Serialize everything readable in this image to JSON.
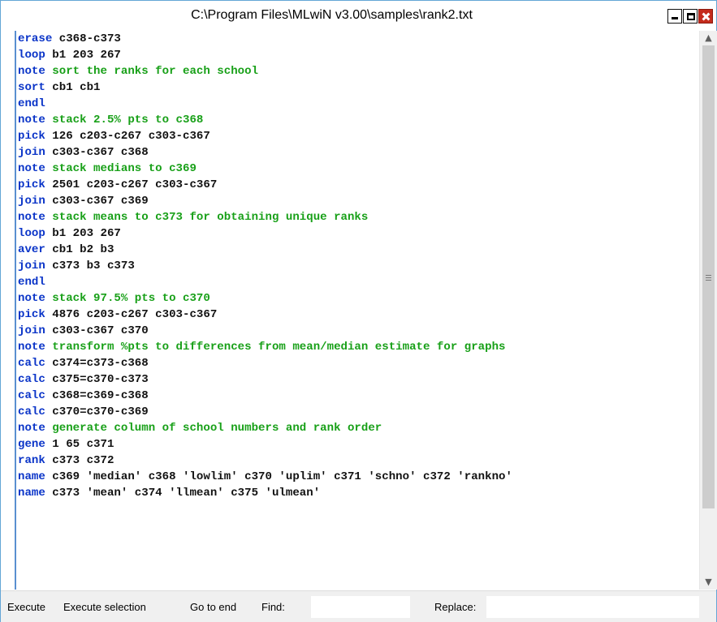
{
  "window": {
    "title": "C:\\Program Files\\MLwiN v3.00\\samples\\rank2.txt"
  },
  "editor": {
    "lines": [
      {
        "kw": "erase",
        "text": " c368-c373",
        "type": "cmd"
      },
      {
        "kw": "loop",
        "text": " b1 203 267",
        "type": "cmd"
      },
      {
        "kw": "note",
        "text": " sort the ranks for each school",
        "type": "note"
      },
      {
        "kw": "sort",
        "text": " cb1 cb1",
        "type": "cmd"
      },
      {
        "kw": "endl",
        "text": "",
        "type": "cmd"
      },
      {
        "kw": "note",
        "text": " stack 2.5% pts to c368",
        "type": "note"
      },
      {
        "kw": "pick",
        "text": " 126 c203-c267 c303-c367",
        "type": "cmd"
      },
      {
        "kw": "join",
        "text": " c303-c367 c368",
        "type": "cmd"
      },
      {
        "kw": "note",
        "text": " stack medians to c369",
        "type": "note"
      },
      {
        "kw": "pick",
        "text": " 2501 c203-c267 c303-c367",
        "type": "cmd"
      },
      {
        "kw": "join",
        "text": " c303-c367 c369",
        "type": "cmd"
      },
      {
        "kw": "note",
        "text": " stack means to c373 for obtaining unique ranks",
        "type": "note"
      },
      {
        "kw": "loop",
        "text": " b1 203 267",
        "type": "cmd"
      },
      {
        "kw": "aver",
        "text": " cb1 b2 b3",
        "type": "cmd"
      },
      {
        "kw": "join",
        "text": " c373 b3 c373",
        "type": "cmd"
      },
      {
        "kw": "endl",
        "text": "",
        "type": "cmd"
      },
      {
        "kw": "note",
        "text": " stack 97.5% pts to c370",
        "type": "note"
      },
      {
        "kw": "pick",
        "text": " 4876 c203-c267 c303-c367",
        "type": "cmd"
      },
      {
        "kw": "join",
        "text": " c303-c367 c370",
        "type": "cmd"
      },
      {
        "kw": "note",
        "text": " transform %pts to differences from mean/median estimate for graphs",
        "type": "note"
      },
      {
        "kw": "calc",
        "text": " c374=c373-c368",
        "type": "cmd"
      },
      {
        "kw": "calc",
        "text": " c375=c370-c373",
        "type": "cmd"
      },
      {
        "kw": "calc",
        "text": " c368=c369-c368",
        "type": "cmd"
      },
      {
        "kw": "calc",
        "text": " c370=c370-c369",
        "type": "cmd"
      },
      {
        "kw": "note",
        "text": " generate column of school numbers and rank order",
        "type": "note"
      },
      {
        "kw": "gene",
        "text": " 1 65 c371",
        "type": "cmd"
      },
      {
        "kw": "rank",
        "text": " c373 c372",
        "type": "cmd"
      },
      {
        "kw": "name",
        "text": " c369 'median' c368 'lowlim' c370 'uplim' c371 'schno' c372 'rankno'",
        "type": "cmd"
      },
      {
        "kw": "name",
        "text": " c373 'mean' c374 'llmean' c375 'ulmean'",
        "type": "cmd"
      }
    ]
  },
  "scrollbar": {
    "up_icon": "▲",
    "down_icon": "▼",
    "grip_icon": "≡"
  },
  "toolbar": {
    "execute_label": "Execute",
    "execute_selection_label": "Execute selection",
    "go_to_end_label": "Go to end",
    "find_label": "Find:",
    "find_value": "",
    "replace_label": "Replace:",
    "replace_value": ""
  },
  "colors": {
    "keyword": "#0a34c8",
    "note": "#18a018",
    "close_button": "#c42b1c"
  }
}
